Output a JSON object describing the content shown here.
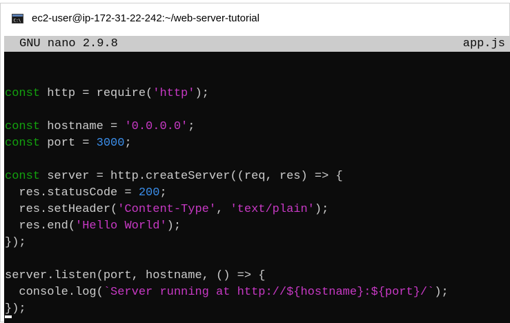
{
  "window": {
    "title": "ec2-user@ip-172-31-22-242:~/web-server-tutorial",
    "icon": "terminal-icon"
  },
  "nano": {
    "version": "GNU nano 2.9.8",
    "filename": "app.js"
  },
  "code": [
    [],
    [
      {
        "t": "const",
        "c": "kw"
      },
      {
        "t": " http = require("
      },
      {
        "t": "'http'",
        "c": "str"
      },
      {
        "t": ");"
      }
    ],
    [],
    [
      {
        "t": "const",
        "c": "kw"
      },
      {
        "t": " hostname = "
      },
      {
        "t": "'0.0.0.0'",
        "c": "str"
      },
      {
        "t": ";"
      }
    ],
    [
      {
        "t": "const",
        "c": "kw"
      },
      {
        "t": " port = "
      },
      {
        "t": "3000",
        "c": "num"
      },
      {
        "t": ";"
      }
    ],
    [],
    [
      {
        "t": "const",
        "c": "kw"
      },
      {
        "t": " server = http.createServer((req, res) => {"
      }
    ],
    [
      {
        "t": "  res.statusCode = "
      },
      {
        "t": "200",
        "c": "num"
      },
      {
        "t": ";"
      }
    ],
    [
      {
        "t": "  res.setHeader("
      },
      {
        "t": "'Content-Type'",
        "c": "str"
      },
      {
        "t": ", "
      },
      {
        "t": "'text/plain'",
        "c": "str"
      },
      {
        "t": ");"
      }
    ],
    [
      {
        "t": "  res.end("
      },
      {
        "t": "'Hello World'",
        "c": "str"
      },
      {
        "t": ");"
      }
    ],
    [
      {
        "t": "});"
      }
    ],
    [],
    [
      {
        "t": "server.listen(port, hostname, () => {"
      }
    ],
    [
      {
        "t": "  console.log("
      },
      {
        "t": "`Server running at http://${hostname}:${port}/`",
        "c": "str"
      },
      {
        "t": ");"
      }
    ],
    [
      {
        "t": "});"
      }
    ]
  ]
}
